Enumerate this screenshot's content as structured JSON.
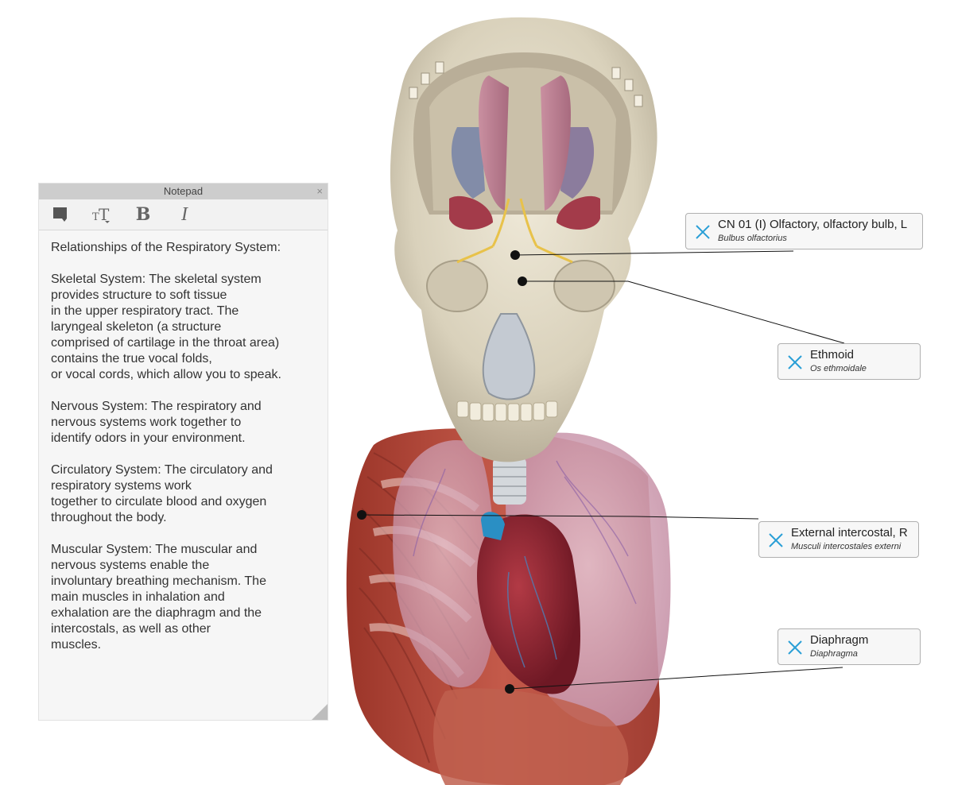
{
  "notepad": {
    "title": "Notepad",
    "close_glyph": "×",
    "toolbar": {
      "color_tool": "color-swatch-icon",
      "text_size_tool": "text-size-icon",
      "bold_label": "B",
      "italic_label": "I"
    },
    "paragraphs": [
      "Relationships of the Respiratory System:",
      "Skeletal System: The skeletal system\nprovides structure to soft tissue\nin the upper respiratory tract. The\nlaryngeal skeleton (a structure\ncomprised of cartilage in the throat area)\ncontains the true vocal folds,\nor vocal cords, which allow you to speak.",
      "Nervous System: The respiratory and\nnervous systems work together to\nidentify odors in your environment.",
      "Circulatory System: The circulatory and\nrespiratory systems work\ntogether to circulate blood and oxygen\nthroughout the body.",
      "Muscular System: The muscular and\nnervous systems enable the\ninvoluntary breathing mechanism. The\nmain muscles in inhalation and\nexhalation are the diaphragm and the\nintercostals, as well as other\nmuscles."
    ]
  },
  "labels": [
    {
      "name": "CN 01 (I) Olfactory, olfactory bulb, L",
      "latin": "Bulbus olfactorius"
    },
    {
      "name": "Ethmoid",
      "latin": "Os ethmoidale"
    },
    {
      "name": "External intercostal, R",
      "latin": "Musculi intercostales externi"
    },
    {
      "name": "Diaphragm",
      "latin": "Diaphragma"
    }
  ],
  "colors": {
    "label_close_icon": "#2a9fd6",
    "bone": "#e8e2cf",
    "muscle": "#b4463a",
    "lung": "#d6a9bd",
    "heart": "#8e2230",
    "brain": "#c98fa0"
  }
}
